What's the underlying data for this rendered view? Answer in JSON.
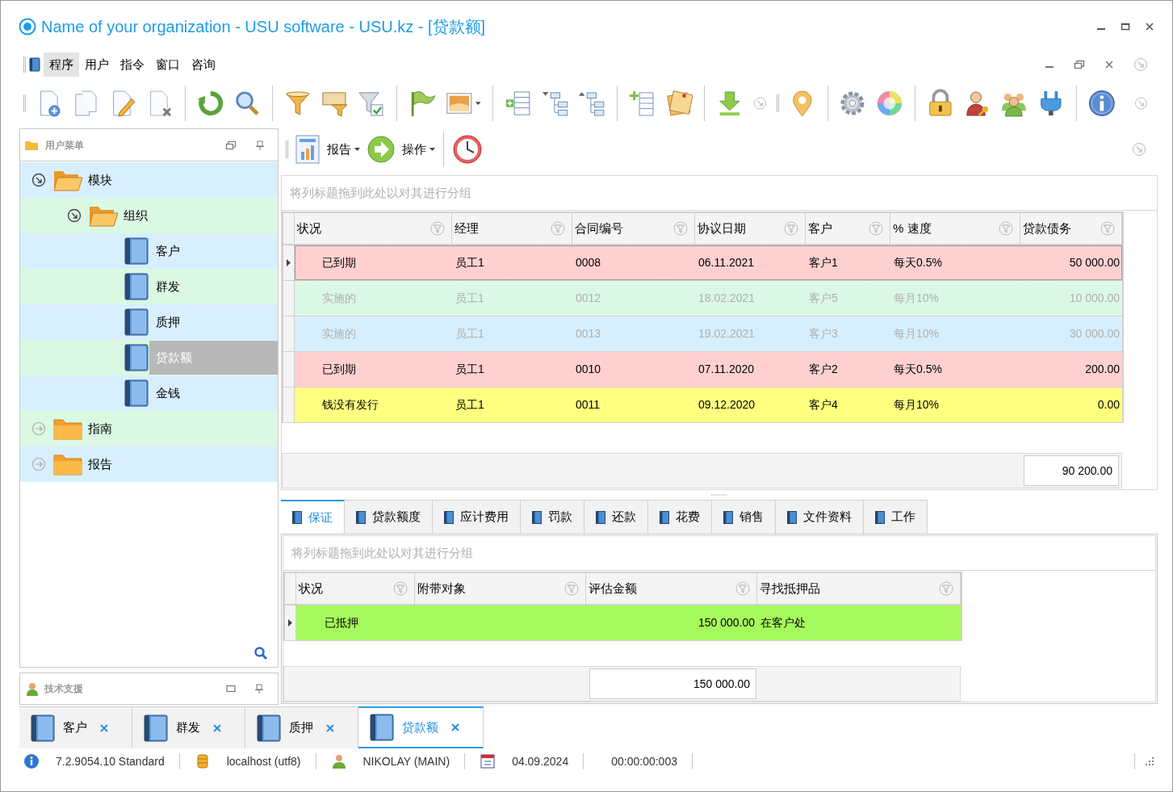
{
  "window": {
    "title": "Name of your organization - USU software - USU.kz - [贷款额]"
  },
  "menu": [
    {
      "label": "程序",
      "selected": true
    },
    {
      "label": "用户",
      "selected": false
    },
    {
      "label": "指令",
      "selected": false
    },
    {
      "label": "窗口",
      "selected": false
    },
    {
      "label": "咨询",
      "selected": false
    }
  ],
  "left_panel": {
    "title": "用户菜单",
    "tree": [
      {
        "label": "模块",
        "kind": "folder",
        "expanded": true,
        "children": [
          {
            "label": "组织",
            "kind": "folder",
            "expanded": true,
            "children": [
              {
                "label": "客户",
                "kind": "module",
                "selected": false
              },
              {
                "label": "群发",
                "kind": "module",
                "selected": false
              },
              {
                "label": "质押",
                "kind": "module",
                "selected": false
              },
              {
                "label": "贷款额",
                "kind": "module",
                "selected": true
              },
              {
                "label": "金钱",
                "kind": "module",
                "selected": false
              }
            ]
          }
        ]
      },
      {
        "label": "指南",
        "kind": "folder",
        "expanded": false
      },
      {
        "label": "报告",
        "kind": "folder",
        "expanded": false
      }
    ]
  },
  "support_panel": {
    "title": "技术支援"
  },
  "sub_toolbar": {
    "buttons": [
      {
        "label": "报告"
      },
      {
        "label": "操作"
      }
    ]
  },
  "main_grid": {
    "group_hint": "将列标题拖到此处以对其进行分组",
    "columns": [
      {
        "label": "状况"
      },
      {
        "label": "经理"
      },
      {
        "label": "合同编号"
      },
      {
        "label": "协议日期"
      },
      {
        "label": "客户"
      },
      {
        "label": "% 速度"
      },
      {
        "label": "贷款债务"
      }
    ],
    "rows": [
      {
        "color": "#ffd0d0",
        "dimmed": false,
        "focused": true,
        "cells": [
          "已到期",
          "员工1",
          "0008",
          "06.11.2021",
          "客户1",
          "每天0.5%",
          "50 000.00"
        ]
      },
      {
        "color": "#daf8e3",
        "dimmed": true,
        "focused": false,
        "cells": [
          "实施的",
          "员工1",
          "0012",
          "18.02.2021",
          "客户5",
          "每月10%",
          "10 000.00"
        ]
      },
      {
        "color": "#d6efff",
        "dimmed": true,
        "focused": false,
        "cells": [
          "实施的",
          "员工1",
          "0013",
          "19.02.2021",
          "客户3",
          "每月10%",
          "30 000.00"
        ]
      },
      {
        "color": "#ffd0d0",
        "dimmed": false,
        "focused": false,
        "cells": [
          "已到期",
          "员工1",
          "0010",
          "07.11.2020",
          "客户2",
          "每天0.5%",
          "200.00"
        ]
      },
      {
        "color": "#ffff80",
        "dimmed": false,
        "focused": false,
        "cells": [
          "钱没有发行",
          "员工1",
          "0011",
          "09.12.2020",
          "客户4",
          "每月10%",
          "0.00"
        ]
      }
    ],
    "total": "90 200.00"
  },
  "detail_tabs": [
    {
      "label": "保证",
      "selected": true
    },
    {
      "label": "贷款额度",
      "selected": false
    },
    {
      "label": "应计费用",
      "selected": false
    },
    {
      "label": "罚款",
      "selected": false
    },
    {
      "label": "还款",
      "selected": false
    },
    {
      "label": "花费",
      "selected": false
    },
    {
      "label": "销售",
      "selected": false
    },
    {
      "label": "文件资料",
      "selected": false
    },
    {
      "label": "工作",
      "selected": false
    }
  ],
  "detail_grid": {
    "group_hint": "将列标题拖到此处以对其进行分组",
    "columns": [
      {
        "label": "状况"
      },
      {
        "label": "附带对象"
      },
      {
        "label": "评估金额"
      },
      {
        "label": "寻找抵押品"
      }
    ],
    "rows": [
      {
        "color": "#a6f95d",
        "focused": true,
        "cells": [
          "已抵押",
          "",
          "150 000.00",
          "在客户处"
        ]
      }
    ],
    "total": "150 000.00"
  },
  "doc_tabs": [
    {
      "label": "客户",
      "selected": false
    },
    {
      "label": "群发",
      "selected": false
    },
    {
      "label": "质押",
      "selected": false
    },
    {
      "label": "贷款额",
      "selected": true
    }
  ],
  "status_bar": [
    {
      "kind": "info",
      "text": "7.2.9054.10 Standard"
    },
    {
      "kind": "database",
      "text": "localhost (utf8)"
    },
    {
      "kind": "user",
      "text": "NIKOLAY (MAIN)"
    },
    {
      "kind": "calendar",
      "text": "04.09.2024"
    },
    {
      "kind": "plain",
      "text": "00:00:00:003"
    }
  ]
}
